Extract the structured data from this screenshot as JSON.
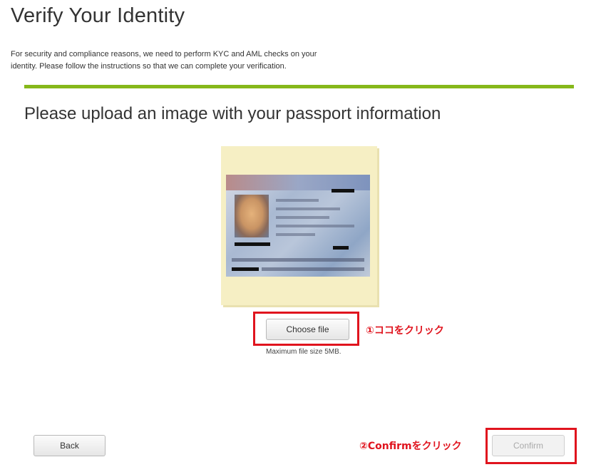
{
  "header": {
    "title": "Verify Your Identity",
    "intro": "For security and compliance reasons, we need to perform KYC and AML checks on your identity. Please follow the instructions so that we can complete your verification."
  },
  "step": {
    "title": "Please upload an image with your passport information",
    "progress": 1.0
  },
  "upload": {
    "choose_label": "Choose file",
    "hint": "Maximum file size 5MB."
  },
  "annotations": {
    "step1": "①ココをクリック",
    "step2": "②Confirmをクリック",
    "color": "#e0141e"
  },
  "footer": {
    "back_label": "Back",
    "confirm_label": "Confirm"
  },
  "colors": {
    "progress_bar": "#86b81a",
    "passport_frame": "#f6efc4"
  }
}
